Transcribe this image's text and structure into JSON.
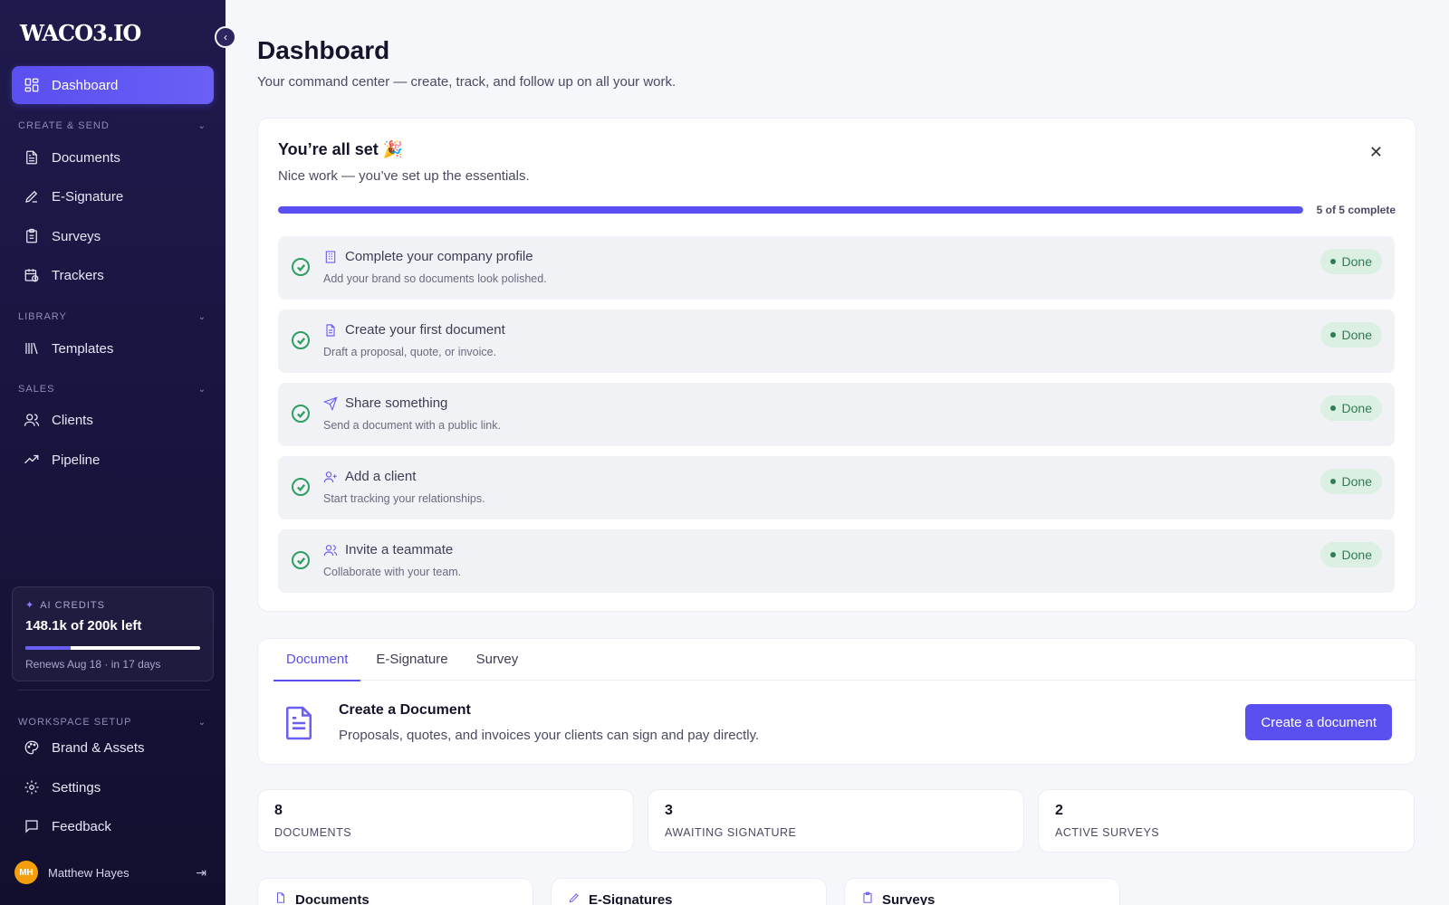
{
  "app": {
    "logo": "WACO3.IO"
  },
  "sidebar": {
    "dashboard": "Dashboard",
    "sections": {
      "create_send": "CREATE & SEND",
      "library": "LIBRARY",
      "sales": "SALES",
      "workspace": "WORKSPACE SETUP"
    },
    "items": {
      "documents": "Documents",
      "esignature": "E-Signature",
      "surveys": "Surveys",
      "trackers": "Trackers",
      "templates": "Templates",
      "clients": "Clients",
      "pipeline": "Pipeline",
      "brand": "Brand & Assets",
      "settings": "Settings",
      "feedback": "Feedback"
    },
    "credits": {
      "title": "AI CREDITS",
      "amount": "148.1k of 200k left",
      "used_fraction": 0.26,
      "renew": "Renews Aug 18 · in 17 days"
    },
    "user": {
      "initials": "MH",
      "name": "Matthew Hayes"
    }
  },
  "header": {
    "title": "Dashboard",
    "subtitle": "Your command center — create, track, and follow up on all your work."
  },
  "setup": {
    "title": "You’re all set 🎉",
    "subtitle": "Nice work — you’ve set up the essentials.",
    "progress_label": "5 of 5 complete",
    "progress_fraction": 1.0,
    "tasks": [
      {
        "name": "Complete your company profile",
        "desc": "Add your brand so documents look polished.",
        "status": "Done"
      },
      {
        "name": "Create your first document",
        "desc": "Draft a proposal, quote, or invoice.",
        "status": "Done"
      },
      {
        "name": "Share something",
        "desc": "Send a document with a public link.",
        "status": "Done"
      },
      {
        "name": "Add a client",
        "desc": "Start tracking your relationships.",
        "status": "Done"
      },
      {
        "name": "Invite a teammate",
        "desc": "Collaborate with your team.",
        "status": "Done"
      }
    ]
  },
  "create": {
    "tabs": [
      "Document",
      "E-Signature",
      "Survey"
    ],
    "title": "Create a Document",
    "subtitle": "Proposals, quotes, and invoices your clients can sign and pay directly.",
    "button": "Create a document"
  },
  "stats": [
    {
      "value": "8",
      "label": "DOCUMENTS"
    },
    {
      "value": "3",
      "label": "AWAITING SIGNATURE"
    },
    {
      "value": "2",
      "label": "ACTIVE SURVEYS"
    }
  ],
  "panels": [
    "Documents",
    "E-Signatures",
    "Surveys"
  ],
  "colors": {
    "accent": "#5a4ff0",
    "success": "#2f7d52",
    "sidebar": "#1f1a4d"
  }
}
